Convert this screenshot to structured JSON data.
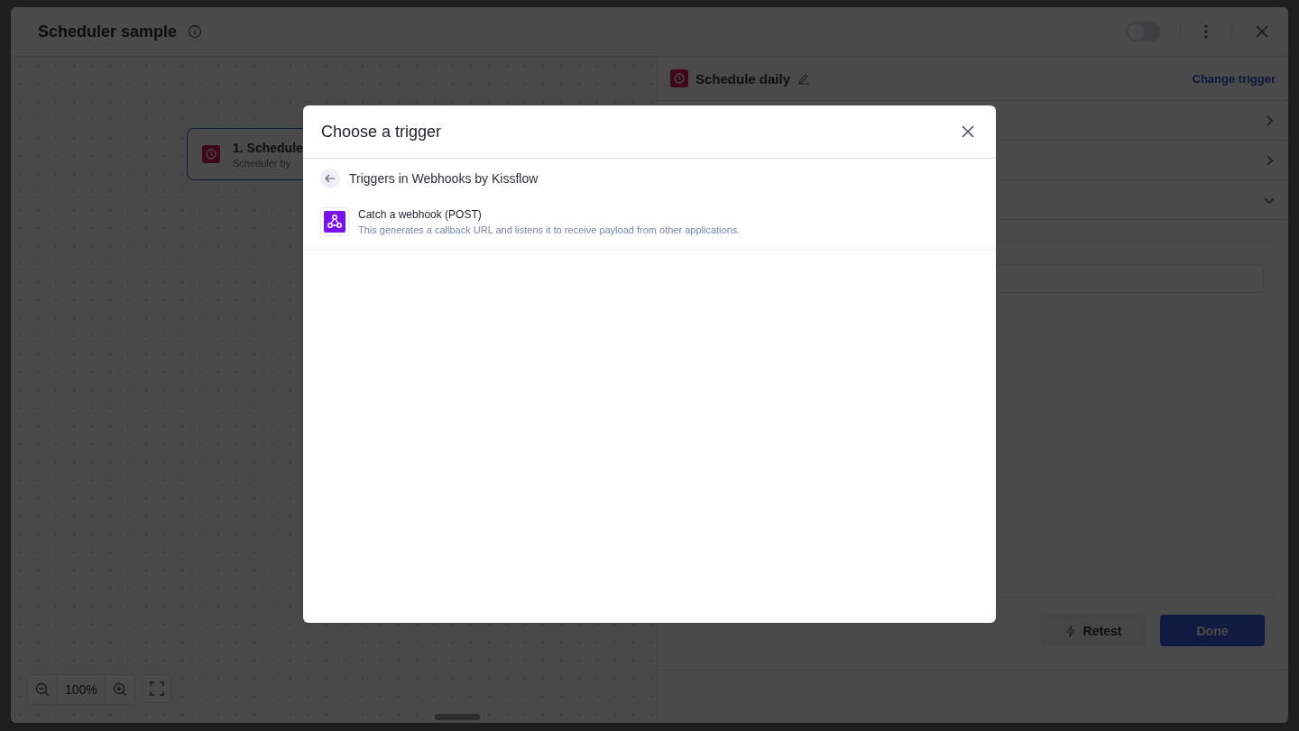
{
  "window": {
    "title": "Scheduler sample",
    "enabled_toggle": {
      "on": false
    }
  },
  "canvas": {
    "node": {
      "title": "1. Schedule",
      "subtitle": "Scheduler by"
    },
    "zoom": {
      "value": "100%"
    }
  },
  "panel": {
    "title": "Schedule daily",
    "action": "Change trigger",
    "sections": [
      {
        "expanded": false
      },
      {
        "expanded": false
      },
      {
        "expanded": true
      }
    ],
    "buttons": [
      {
        "label": "Retest",
        "kind": "secondary"
      },
      {
        "label": "Done",
        "kind": "primary"
      }
    ]
  },
  "modal": {
    "title": "Choose a trigger",
    "breadcrumb": "Triggers in Webhooks by Kissflow",
    "triggers": [
      {
        "name": "Catch a webhook (POST)",
        "description": "This generates a callback URL and listens it to receive payload from other applications."
      }
    ]
  }
}
